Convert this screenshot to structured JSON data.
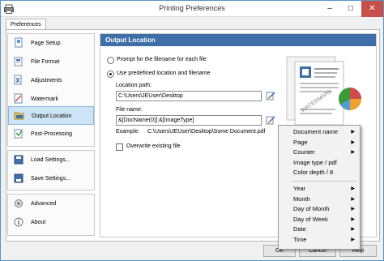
{
  "window": {
    "title": "Printing Preferences"
  },
  "tabs": [
    {
      "label": "Preferences"
    }
  ],
  "sidebar": {
    "items": [
      {
        "label": "Page Setup",
        "icon": "page-setup-icon"
      },
      {
        "label": "File Format",
        "icon": "file-format-icon"
      },
      {
        "label": "Adjustments",
        "icon": "adjustments-icon"
      },
      {
        "label": "Watermark",
        "icon": "watermark-icon"
      },
      {
        "label": "Output Location",
        "icon": "folder-icon",
        "active": true
      },
      {
        "label": "Post-Processing",
        "icon": "post-processing-icon"
      },
      {
        "label": "Load Settings...",
        "icon": "load-settings-icon"
      },
      {
        "label": "Save Settings...",
        "icon": "save-settings-icon"
      },
      {
        "label": "Advanced",
        "icon": "advanced-icon"
      },
      {
        "label": "About",
        "icon": "about-icon"
      }
    ]
  },
  "output": {
    "header": "Output Location",
    "prompt_option": "Prompt for the filename for each file",
    "predefined_option": "Use predefined location and filename",
    "location_label": "Location path:",
    "location_value": "C:\\Users\\JEUser\\Desktop",
    "filename_label": "File name:",
    "filename_value": "&[DocName(0)].&[ImageType]",
    "example_label": "Example:",
    "example_value": "C:\\Users\\JEUser\\Desktop\\Some Document.pdf",
    "overwrite_label": "Overwrite existing file",
    "overwrite_checked": false
  },
  "preview": {
    "watermark_text": "WATERMARK"
  },
  "buttons": {
    "ok": "OK",
    "cancel": "Cancel",
    "help": "Help"
  },
  "context_menu": {
    "items": [
      {
        "label": "Document name",
        "submenu": true
      },
      {
        "label": "Page",
        "submenu": true
      },
      {
        "label": "Counter",
        "submenu": true
      },
      {
        "label": "Image type / pdf",
        "submenu": false
      },
      {
        "label": "Color depth / 8",
        "submenu": false
      },
      {
        "label": "Year",
        "submenu": true
      },
      {
        "label": "Month",
        "submenu": true
      },
      {
        "label": "Day of Month",
        "submenu": true
      },
      {
        "label": "Day of Week",
        "submenu": true
      },
      {
        "label": "Date",
        "submenu": true
      },
      {
        "label": "Time",
        "submenu": true
      }
    ]
  },
  "colors": {
    "accent": "#3f6fa8",
    "selected": "#cde3f6",
    "close": "#c7504a"
  }
}
